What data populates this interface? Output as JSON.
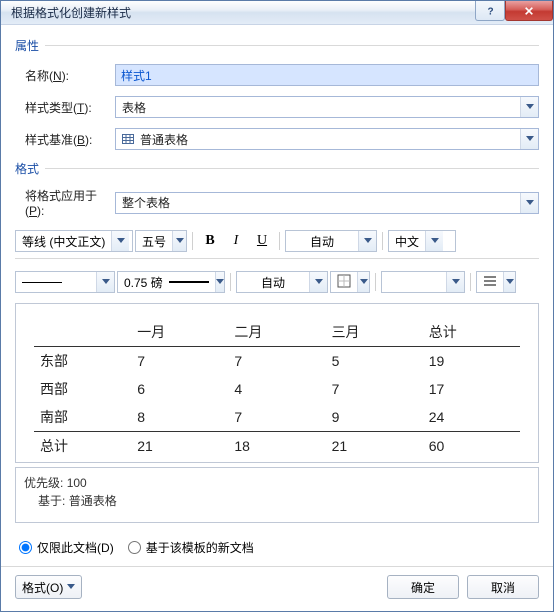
{
  "window": {
    "title": "根据格式化创建新样式"
  },
  "groups": {
    "props": "属性",
    "format": "格式"
  },
  "labels": {
    "name": "名称",
    "name_key": "N",
    "type": "样式类型",
    "type_key": "T",
    "base": "样式基准",
    "base_key": "B",
    "apply": "将格式应用于",
    "apply_key": "P",
    "only_doc": "仅限此文档",
    "only_doc_key": "D",
    "template_docs": "基于该模板的新文档"
  },
  "fields": {
    "name_value": "样式1",
    "type_value": "表格",
    "base_value": "普通表格",
    "apply_value": "整个表格"
  },
  "toolbar": {
    "font": "等线 (中文正文)",
    "size": "五号",
    "color_auto": "自动",
    "lang": "中文",
    "line_weight": "0.75 磅",
    "border_auto": "自动"
  },
  "preview": {
    "headers": [
      "",
      "一月",
      "二月",
      "三月",
      "总计"
    ],
    "rows": [
      [
        "东部",
        "7",
        "7",
        "5",
        "19"
      ],
      [
        "西部",
        "6",
        "4",
        "7",
        "17"
      ],
      [
        "南部",
        "8",
        "7",
        "9",
        "24"
      ],
      [
        "总计",
        "21",
        "18",
        "21",
        "60"
      ]
    ]
  },
  "info": {
    "priority_label": "优先级:",
    "priority_value": "100",
    "based_on_label": "基于:",
    "based_on_value": "普通表格"
  },
  "footer": {
    "format_btn": "格式",
    "format_key": "O",
    "ok": "确定",
    "cancel": "取消"
  }
}
